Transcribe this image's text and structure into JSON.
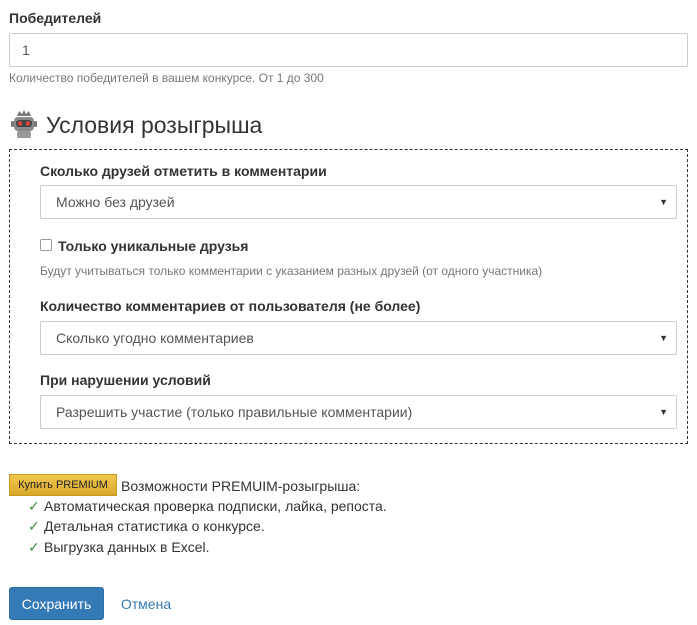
{
  "winners": {
    "label": "Победителей",
    "value": "1",
    "hint": "Количество победителей в вашем конкурсе. От 1 до 300"
  },
  "conditions": {
    "title": "Условия розыгрыша",
    "icon": "robot-king-icon",
    "friends": {
      "label": "Сколько друзей отметить в комментарии",
      "selected": "Можно без друзей"
    },
    "unique": {
      "label": "Только уникальные друзья",
      "checked": false,
      "hint": "Будут учитываться только комментарии с указанием разных друзей (от одного участника)"
    },
    "comments": {
      "label": "Количество комментариев от пользователя (не более)",
      "selected": "Сколько угодно комментариев"
    },
    "violation": {
      "label": "При нарушении условий",
      "selected": "Разрешить участие (только правильные комментарии)"
    }
  },
  "premium": {
    "button": "Купить PREMIUM",
    "title": "Возможности PREMUIM-розыгрыша:",
    "check_mark": "✓",
    "features": [
      "Автоматическая проверка подписки, лайка, репоста.",
      "Детальная статистика о конкурсе.",
      "Выгрузка данных в Excel."
    ]
  },
  "actions": {
    "save": "Сохранить",
    "cancel": "Отмена"
  },
  "colors": {
    "primary": "#337ab7",
    "premium": "#e6b93a",
    "check": "#3c8a3c"
  }
}
